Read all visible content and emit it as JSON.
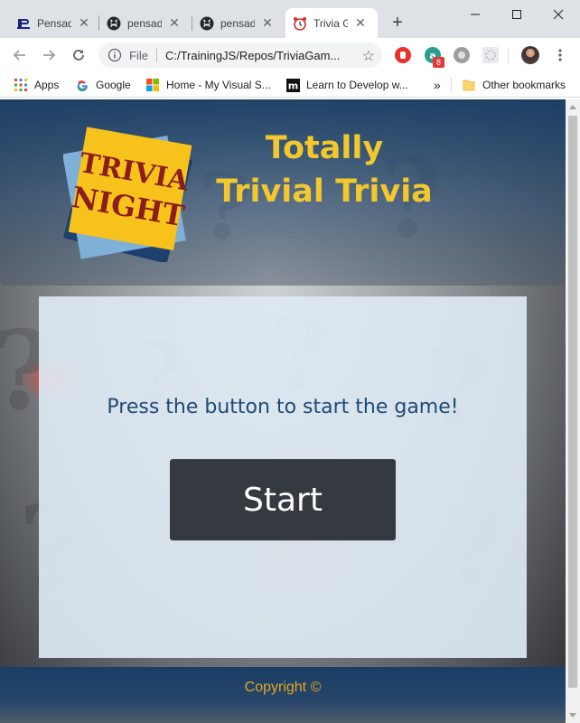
{
  "browser": {
    "tabs": [
      {
        "title": "Pensad",
        "icon": "pensado-icon",
        "active": false
      },
      {
        "title": "pensad",
        "icon": "github-icon",
        "active": false
      },
      {
        "title": "pensad",
        "icon": "github-icon",
        "active": false
      },
      {
        "title": "Trivia G",
        "icon": "alarm-clock-icon",
        "active": true
      }
    ],
    "new_tab": "+",
    "address": {
      "file_label": "File",
      "url": "C:/TrainingJS/Repos/TriviaGam..."
    },
    "extension_badge": "8",
    "bookmarks": [
      {
        "label": "Apps",
        "icon": "apps-grid-icon"
      },
      {
        "label": "Google",
        "icon": "google-icon"
      },
      {
        "label": "Home - My Visual S...",
        "icon": "microsoft-icon"
      },
      {
        "label": "Learn to Develop w...",
        "icon": "m-logo-icon"
      }
    ],
    "overflow": "»",
    "other_bookmarks": "Other bookmarks"
  },
  "page": {
    "logo_text_line1": "TRIVIA",
    "logo_text_line2": "NIGHT",
    "title": "Totally Trivial Trivia",
    "prompt": "Press the button to start the game!",
    "start_button": "Start",
    "copyright": "Copyright ©"
  },
  "colors": {
    "header_blue": "#1a3e65",
    "title_yellow": "#f2c82e",
    "prompt_blue": "#1d4a75",
    "button_dark": "#343a40",
    "copyright_gold": "#e0a820"
  }
}
